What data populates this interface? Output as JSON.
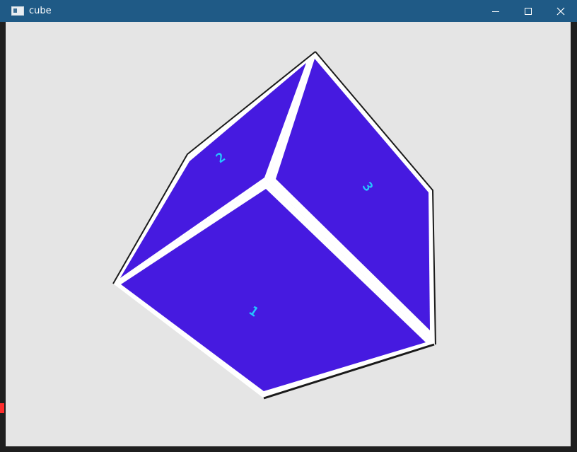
{
  "window": {
    "title": "cube",
    "icon": "window-app-icon",
    "controls": [
      {
        "name": "minimize-button",
        "icon": "minimize-icon"
      },
      {
        "name": "maximize-button",
        "icon": "maximize-icon"
      },
      {
        "name": "close-button",
        "icon": "close-icon"
      }
    ]
  },
  "viewport": {
    "background": "#e5e5e5"
  },
  "cube": {
    "face_color": "#461ae0",
    "edge_color": "#ffffff",
    "label_color": "#25c7ff",
    "faces": [
      {
        "name": "face-top-left",
        "label": "2"
      },
      {
        "name": "face-right",
        "label": "3"
      },
      {
        "name": "face-front",
        "label": "1"
      }
    ]
  }
}
